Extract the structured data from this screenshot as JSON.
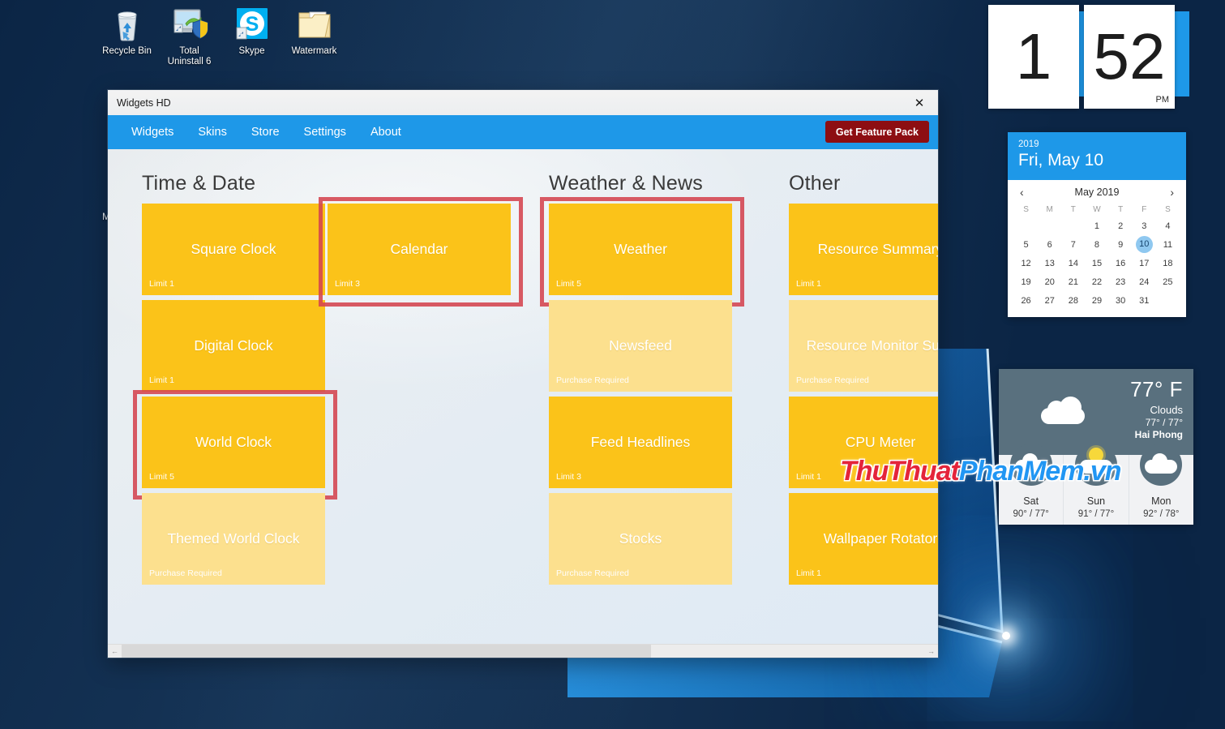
{
  "desktop": {
    "icons": [
      {
        "label": "Recycle Bin",
        "icon": "recycle-bin-icon"
      },
      {
        "label": "Total\nUninstall 6",
        "icon": "total-uninstall-icon"
      },
      {
        "label": "Skype",
        "icon": "skype-icon"
      },
      {
        "label": "Watermark",
        "icon": "folder-icon"
      }
    ],
    "stray_text": "M",
    "watermark": {
      "part1": "ThuThuat",
      "part2": "PhanMem.vn"
    }
  },
  "window": {
    "title": "Widgets HD",
    "close_label": "✕",
    "menu": [
      {
        "label": "Widgets"
      },
      {
        "label": "Skins"
      },
      {
        "label": "Store"
      },
      {
        "label": "Settings"
      },
      {
        "label": "About"
      }
    ],
    "feature_pack_button": "Get Feature Pack",
    "scrollbar": {
      "left_arrow": "←",
      "right_arrow": "→"
    },
    "columns": [
      {
        "title": "Time & Date",
        "tiles": [
          {
            "name": "Square Clock",
            "status": "Limit 1",
            "paid": false,
            "highlighted": false
          },
          {
            "name": "Digital Clock",
            "status": "Limit 1",
            "paid": false,
            "highlighted": false
          },
          {
            "name": "World Clock",
            "status": "Limit 5",
            "paid": false,
            "highlighted": true
          },
          {
            "name": "Themed World Clock",
            "status": "Purchase Required",
            "paid": true,
            "highlighted": false
          }
        ]
      },
      {
        "title": "",
        "tiles": [
          {
            "name": "Calendar",
            "status": "Limit 3",
            "paid": false,
            "highlighted": true
          }
        ]
      },
      {
        "title": "Weather & News",
        "tiles": [
          {
            "name": "Weather",
            "status": "Limit 5",
            "paid": false,
            "highlighted": true
          },
          {
            "name": "Newsfeed",
            "status": "Purchase Required",
            "paid": true,
            "highlighted": false
          },
          {
            "name": "Feed Headlines",
            "status": "Limit 3",
            "paid": false,
            "highlighted": false
          },
          {
            "name": "Stocks",
            "status": "Purchase Required",
            "paid": true,
            "highlighted": false
          }
        ]
      },
      {
        "title": "Other",
        "tiles": [
          {
            "name": "Resource Summary",
            "status": "Limit 1",
            "paid": false,
            "highlighted": false
          },
          {
            "name": "Resource Monitor Suite",
            "status": "Purchase Required",
            "paid": true,
            "highlighted": false
          },
          {
            "name": "CPU Meter",
            "status": "Limit 1",
            "paid": false,
            "highlighted": false
          },
          {
            "name": "Wallpaper Rotator",
            "status": "Limit 1",
            "paid": false,
            "highlighted": false
          }
        ]
      }
    ]
  },
  "gadgets": {
    "clock": {
      "hour": "1",
      "minute": "52",
      "meridiem": "PM"
    },
    "calendar": {
      "year": "2019",
      "date_line": "Fri, May 10",
      "month_label": "May 2019",
      "prev": "‹",
      "next": "›",
      "weekdays": [
        "S",
        "M",
        "T",
        "W",
        "T",
        "F",
        "S"
      ],
      "weeks": [
        [
          "",
          "",
          "",
          "1",
          "2",
          "3",
          "4"
        ],
        [
          "5",
          "6",
          "7",
          "8",
          "9",
          "10",
          "11"
        ],
        [
          "12",
          "13",
          "14",
          "15",
          "16",
          "17",
          "18"
        ],
        [
          "19",
          "20",
          "21",
          "22",
          "23",
          "24",
          "25"
        ],
        [
          "26",
          "27",
          "28",
          "29",
          "30",
          "31",
          ""
        ]
      ],
      "today": "10"
    },
    "weather": {
      "temperature": "77° F",
      "condition": "Clouds",
      "range": "77° / 77°",
      "city": "Hai Phong",
      "forecast": [
        {
          "day": "Sat",
          "temps": "90° / 77°",
          "icon": "cloud-icon"
        },
        {
          "day": "Sun",
          "temps": "91° / 77°",
          "icon": "sun-cloud-icon"
        },
        {
          "day": "Mon",
          "temps": "92° / 78°",
          "icon": "cloud-icon"
        }
      ]
    }
  },
  "colors": {
    "accent_blue": "#1e98e8",
    "tile_free": "#fbc319",
    "tile_paid": "#fce08e",
    "highlight_red": "#d4434f",
    "feature_pack": "#8d0e12"
  }
}
